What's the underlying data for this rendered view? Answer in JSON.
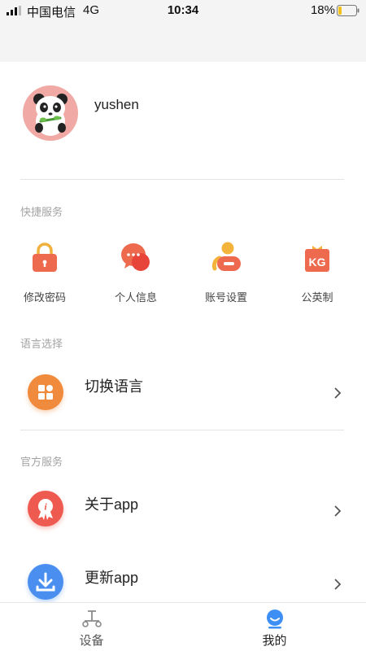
{
  "status_bar": {
    "carrier": "中国电信",
    "network": "4G",
    "time": "10:34",
    "battery_percent": "18%",
    "battery_level": 0.18
  },
  "profile": {
    "username": "yushen"
  },
  "quick_services": {
    "title": "快捷服务",
    "items": [
      {
        "label": "修改密码",
        "icon": "lock-icon"
      },
      {
        "label": "个人信息",
        "icon": "chat-bubbles-icon"
      },
      {
        "label": "账号设置",
        "icon": "users-icon"
      },
      {
        "label": "公英制",
        "icon": "kg-gift-icon"
      }
    ]
  },
  "language": {
    "title": "语言选择",
    "switch_label": "切换语言",
    "icon": "apps-grid-icon"
  },
  "official": {
    "title": "官方服务",
    "items": [
      {
        "label": "关于app",
        "icon": "info-badge-icon"
      },
      {
        "label": "更新app",
        "icon": "download-icon"
      }
    ]
  },
  "tabbar": {
    "tabs": [
      {
        "label": "设备",
        "icon": "device-icon",
        "active": false
      },
      {
        "label": "我的",
        "icon": "profile-smile-icon",
        "active": true
      }
    ]
  },
  "colors": {
    "accent_blue": "#3d8ef5",
    "orange": "#f08a3c",
    "red": "#ee5a4f",
    "divider": "#e3e3e3"
  }
}
